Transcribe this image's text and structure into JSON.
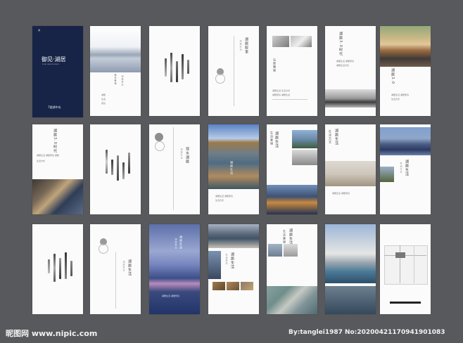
{
  "cover": {
    "title": "御见·湖居",
    "subtitle": "ROYAL LAKE RESIDENCE",
    "brand": "7號湖中岛",
    "logo_text": "湖"
  },
  "headings": {
    "era_30_a": "湖居3.0时代",
    "era_30_b": "湖居3.0时代",
    "era_30_c": "湖居3.0时代",
    "culture": "尚文筑岛",
    "lake_story": "湖居叙事",
    "island_life": "岛居雅境",
    "water_view": "观水湖居",
    "rhythm": "湖居生活",
    "landscape": "湖光山色"
  },
  "footer": {
    "site": "昵图网 www.nipic.com",
    "credit": "By:tanglei1987 No:20200421170941901083"
  }
}
